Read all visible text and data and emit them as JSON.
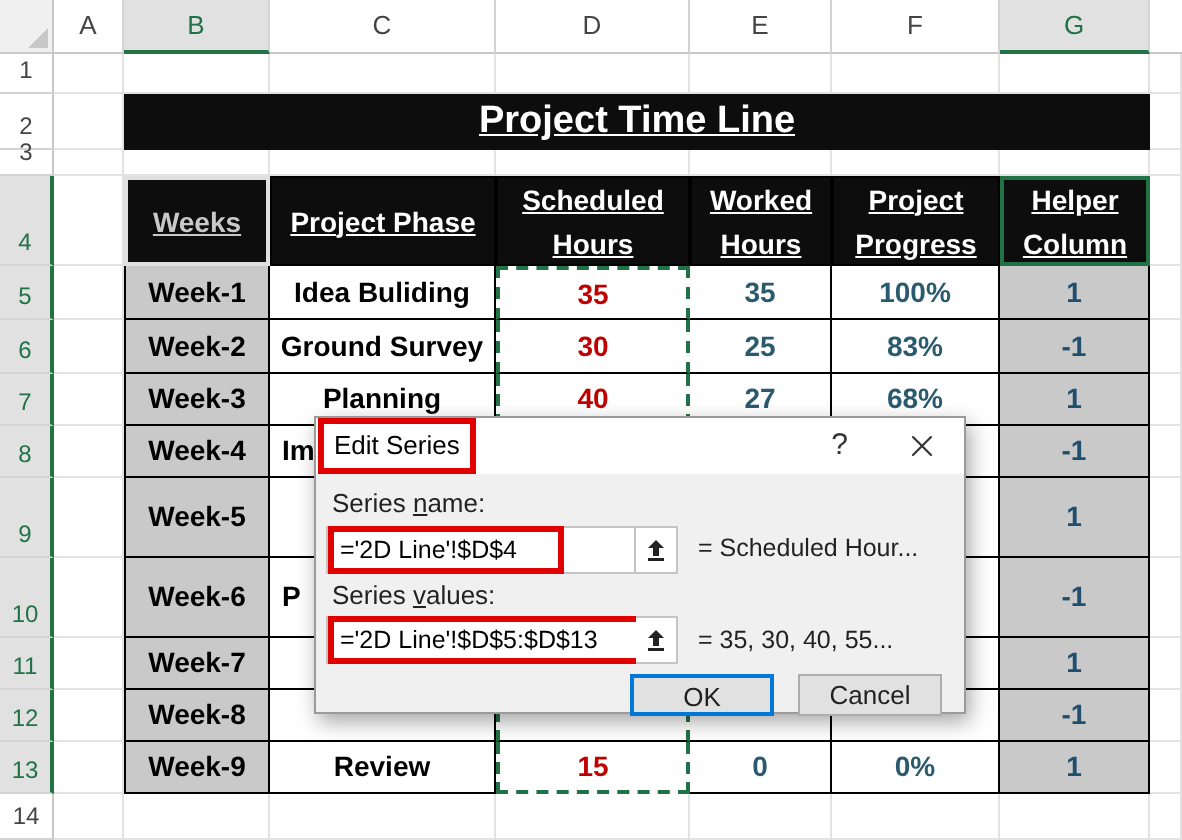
{
  "column_headers": [
    {
      "label": "A",
      "selected": false
    },
    {
      "label": "B",
      "selected": true
    },
    {
      "label": "C",
      "selected": false
    },
    {
      "label": "D",
      "selected": false
    },
    {
      "label": "E",
      "selected": false
    },
    {
      "label": "F",
      "selected": false
    },
    {
      "label": "G",
      "selected": true
    }
  ],
  "row_headers": [
    {
      "label": "1",
      "selected": false
    },
    {
      "label": "2",
      "selected": false
    },
    {
      "label": "3",
      "selected": false
    },
    {
      "label": "4",
      "selected": true
    },
    {
      "label": "5",
      "selected": true
    },
    {
      "label": "6",
      "selected": true
    },
    {
      "label": "7",
      "selected": true
    },
    {
      "label": "8",
      "selected": true
    },
    {
      "label": "9",
      "selected": true
    },
    {
      "label": "10",
      "selected": true
    },
    {
      "label": "11",
      "selected": true
    },
    {
      "label": "12",
      "selected": true
    },
    {
      "label": "13",
      "selected": true
    },
    {
      "label": "14",
      "selected": false
    }
  ],
  "title": "Project Time Line",
  "table": {
    "columns": [
      {
        "label": "Weeks",
        "dimmed": true,
        "active": false,
        "marquee": false
      },
      {
        "label": "Project Phase",
        "dimmed": false,
        "active": false,
        "marquee": false
      },
      {
        "label": "Scheduled Hours",
        "dimmed": false,
        "active": false,
        "marquee": true
      },
      {
        "label": "Worked Hours",
        "dimmed": false,
        "active": false,
        "marquee": false
      },
      {
        "label": "Project Progress",
        "dimmed": false,
        "active": false,
        "marquee": false
      },
      {
        "label": "Helper Column",
        "dimmed": false,
        "active": true,
        "marquee": false
      }
    ],
    "rows": [
      {
        "week": "Week-1",
        "phase": "Idea Buliding",
        "scheduled": "35",
        "worked": "35",
        "progress": "100%",
        "helper": "1"
      },
      {
        "week": "Week-2",
        "phase": "Ground Survey",
        "scheduled": "30",
        "worked": "25",
        "progress": "83%",
        "helper": "-1"
      },
      {
        "week": "Week-3",
        "phase": "Planning",
        "scheduled": "40",
        "worked": "27",
        "progress": "68%",
        "helper": "1"
      },
      {
        "week": "Week-4",
        "phase_fragment": "Im",
        "helper": "-1"
      },
      {
        "week": "Week-5",
        "helper": "1"
      },
      {
        "week": "Week-6",
        "phase_fragment": "P",
        "helper": "-1"
      },
      {
        "week": "Week-7",
        "helper": "1"
      },
      {
        "week": "Week-8",
        "helper": "-1"
      },
      {
        "week": "Week-9",
        "phase": "Review",
        "scheduled": "15",
        "worked": "0",
        "progress": "0%",
        "helper": "1"
      }
    ]
  },
  "dialog": {
    "title": "Edit Series",
    "help": "?",
    "fields": [
      {
        "label": {
          "before": "Series ",
          "key": "n",
          "after": "ame:"
        },
        "value": "='2D Line'!$D$4",
        "result": "= Scheduled Hour..."
      },
      {
        "label": {
          "before": "Series ",
          "key": "v",
          "after": "alues:"
        },
        "value": "='2D Line'!$D$5:$D$13",
        "result": "= 35, 30, 40, 55..."
      }
    ],
    "buttons": [
      {
        "label": "OK",
        "default": true
      },
      {
        "label": "Cancel",
        "default": false
      }
    ]
  }
}
